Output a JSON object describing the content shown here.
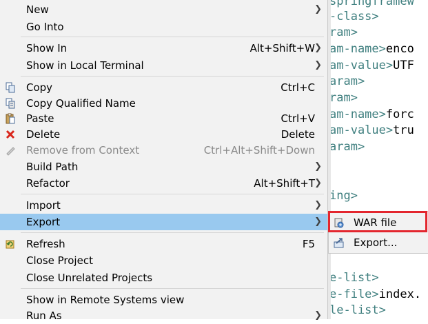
{
  "editor": {
    "lines": [
      {
        "tag": "springframew",
        "text": ""
      },
      {
        "tag": "-class>",
        "text": ""
      },
      {
        "tag": "ram>",
        "text": ""
      },
      {
        "tag": "am-name>",
        "text": "enco"
      },
      {
        "tag": "am-value>",
        "text": "UTF"
      },
      {
        "tag": "aram>",
        "text": ""
      },
      {
        "tag": "ram>",
        "text": ""
      },
      {
        "tag": "am-name>",
        "text": "forc"
      },
      {
        "tag": "am-value>",
        "text": "tru"
      },
      {
        "tag": "aram>",
        "text": ""
      },
      {
        "tag": "ing>",
        "text": ""
      },
      {
        "tag": "e-list>",
        "text": ""
      },
      {
        "tag": "e-file>",
        "text": "index."
      },
      {
        "tag": "le-list>",
        "text": ""
      }
    ]
  },
  "menu": {
    "new": {
      "label": "New"
    },
    "go_into": {
      "label": "Go Into"
    },
    "show_in": {
      "label": "Show In",
      "accel": "Alt+Shift+W"
    },
    "show_local_terminal": {
      "label": "Show in Local Terminal"
    },
    "copy": {
      "label": "Copy",
      "accel": "Ctrl+C"
    },
    "copy_qualified": {
      "label": "Copy Qualified Name"
    },
    "paste": {
      "label": "Paste",
      "accel": "Ctrl+V"
    },
    "delete": {
      "label": "Delete",
      "accel": "Delete"
    },
    "remove_context": {
      "label": "Remove from Context",
      "accel": "Ctrl+Alt+Shift+Down"
    },
    "build_path": {
      "label": "Build Path"
    },
    "refactor": {
      "label": "Refactor",
      "accel": "Alt+Shift+T"
    },
    "import": {
      "label": "Import"
    },
    "export": {
      "label": "Export"
    },
    "refresh": {
      "label": "Refresh",
      "accel": "F5"
    },
    "close_project": {
      "label": "Close Project"
    },
    "close_unrelated": {
      "label": "Close Unrelated Projects"
    },
    "show_remote": {
      "label": "Show in Remote Systems view"
    },
    "run_as": {
      "label": "Run As"
    }
  },
  "submenu": {
    "war_file": {
      "label": "WAR file"
    },
    "export_wizard": {
      "label": "Export..."
    }
  },
  "colors": {
    "highlight": "#99c9ef",
    "annotation_box": "#e3262e",
    "tag": "#3f7f7f"
  }
}
